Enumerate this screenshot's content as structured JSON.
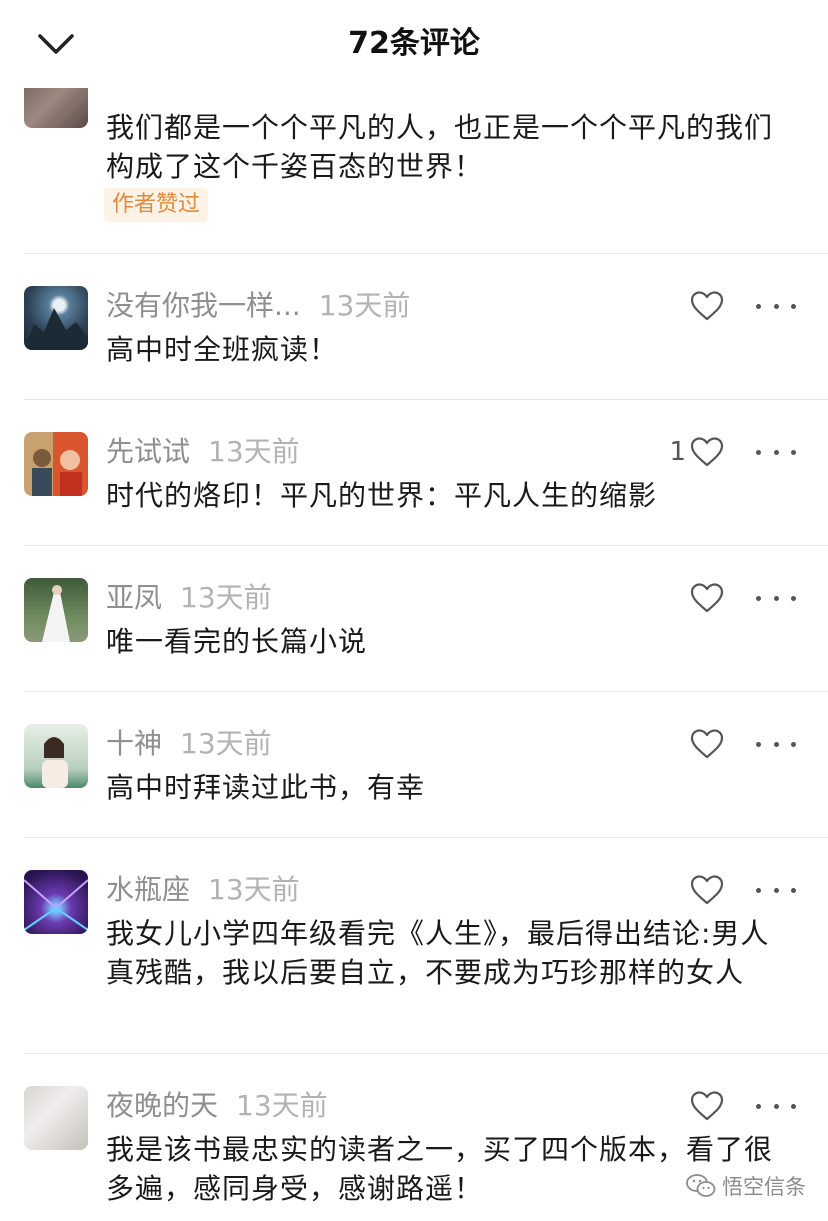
{
  "header": {
    "title": "72条评论"
  },
  "top_partial": {
    "text": "我们都是一个个平凡的人，也正是一个个平凡的我们构成了这个千姿百态的世界！",
    "badge": "作者赞过"
  },
  "comments": [
    {
      "username": "没有你我一样...",
      "time": "13天前",
      "text": "高中时全班疯读！",
      "likes": ""
    },
    {
      "username": "先试试",
      "time": "13天前",
      "text": "时代的烙印！平凡的世界：平凡人生的缩影",
      "likes": "1"
    },
    {
      "username": "亚凤",
      "time": "13天前",
      "text": "唯一看完的长篇小说",
      "likes": ""
    },
    {
      "username": "十神",
      "time": "13天前",
      "text": "高中时拜读过此书，有幸",
      "likes": ""
    },
    {
      "username": "水瓶座",
      "time": "13天前",
      "text": "我女儿小学四年级看完《人生》，最后得出结论:男人真残酷，我以后要自立，不要成为巧珍那样的女人",
      "likes": ""
    },
    {
      "username": "夜晚的天",
      "time": "13天前",
      "text": "我是该书最忠实的读者之一，买了四个版本，看了很多遍，感同身受，感谢路遥！",
      "likes": ""
    }
  ],
  "watermark": {
    "text": "悟空信条"
  },
  "icons": {
    "back": "chevron-down-icon",
    "like": "heart-outline-icon",
    "more": "more-dots-icon"
  },
  "colors": {
    "badge_text": "#e08a3c",
    "badge_bg": "#fdf2e6",
    "username": "#8f8f8f",
    "time": "#b3b3b3"
  }
}
